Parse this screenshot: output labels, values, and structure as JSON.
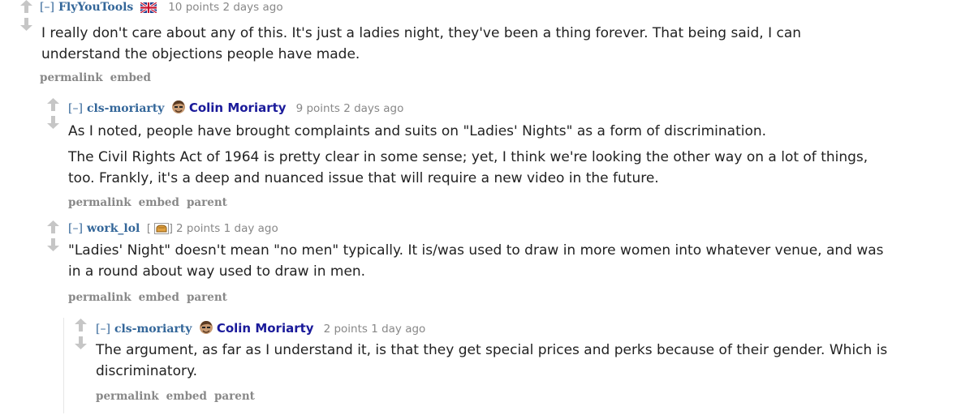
{
  "comments": [
    {
      "expand": "[–]",
      "author": "FlyYouTools",
      "flag": "uk-flag-icon",
      "score_time": "10 points 2 days ago",
      "paragraphs": [
        "I really don't care about any of this. It's just a ladies night, they've been a thing forever. That being said, I can",
        "understand the objections people have made."
      ],
      "buttons": [
        "permalink",
        "embed"
      ]
    },
    {
      "expand": "[–]",
      "author": "cls-moriarty",
      "flair": "Colin Moriarty",
      "score_time": "9 points 2 days ago",
      "paragraphs": [
        "As I noted, people have brought complaints and suits on \"Ladies' Nights\" as a form of discrimination.",
        "The Civil Rights Act of 1964 is pretty clear in some sense; yet, I think we're looking the other way on a lot of things,",
        "too. Frankly, it's a deep and nuanced issue that will require a new video in the future."
      ],
      "buttons": [
        "permalink",
        "embed",
        "parent"
      ]
    },
    {
      "expand": "[–]",
      "author": "work_lol",
      "flair_open": "[",
      "flair_close": "]",
      "score_time": "2 points 1 day ago",
      "paragraphs": [
        "\"Ladies' Night\" doesn't mean \"no men\" typically. It is/was used to draw in more women into whatever venue, and was",
        "in a round about way used to draw in men."
      ],
      "buttons": [
        "permalink",
        "embed",
        "parent"
      ]
    },
    {
      "expand": "[–]",
      "author": "cls-moriarty",
      "flair": "Colin Moriarty",
      "score_time": "2 points 1 day ago",
      "paragraphs": [
        "The argument, as far as I understand it, is that they get special prices and perks because of their gender. Which is",
        "discriminatory."
      ],
      "buttons": [
        "permalink",
        "embed",
        "parent"
      ]
    }
  ]
}
